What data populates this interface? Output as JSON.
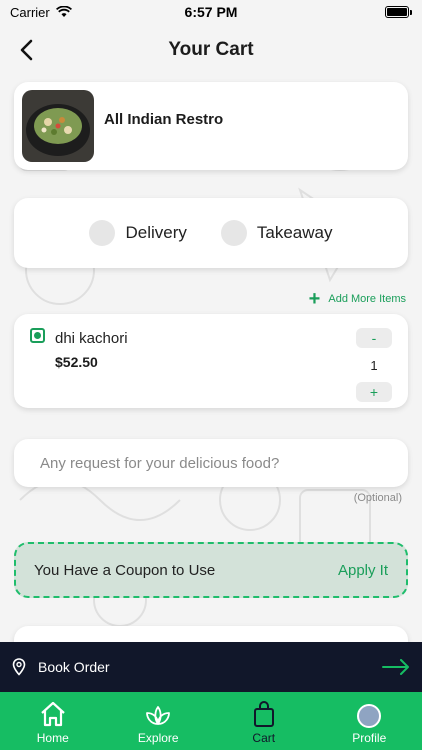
{
  "status_bar": {
    "carrier": "Carrier",
    "time": "6:57 PM"
  },
  "header": {
    "title": "Your Cart"
  },
  "restaurant": {
    "name": "All Indian Restro"
  },
  "order_type": {
    "options": [
      "Delivery",
      "Takeaway"
    ]
  },
  "add_more": {
    "label": "Add More Items"
  },
  "cart_item": {
    "name": "dhi kachori",
    "price": "$52.50",
    "quantity": "1",
    "minus": "-",
    "plus": "+"
  },
  "request": {
    "placeholder": "Any request for your delicious food?",
    "optional_label": "(Optional)"
  },
  "coupon": {
    "text": "You Have a Coupon to Use",
    "action": "Apply It"
  },
  "book_order": {
    "label": "Book Order"
  },
  "tabs": [
    {
      "label": "Home",
      "icon": "home-icon"
    },
    {
      "label": "Explore",
      "icon": "leaf-icon"
    },
    {
      "label": "Cart",
      "icon": "bag-icon"
    },
    {
      "label": "Profile",
      "icon": "avatar-icon"
    }
  ],
  "colors": {
    "accent": "#16bd63",
    "accent_text": "#1a9e5a",
    "dark_bar": "#11172a",
    "coupon_bg": "#d3e2d9"
  }
}
